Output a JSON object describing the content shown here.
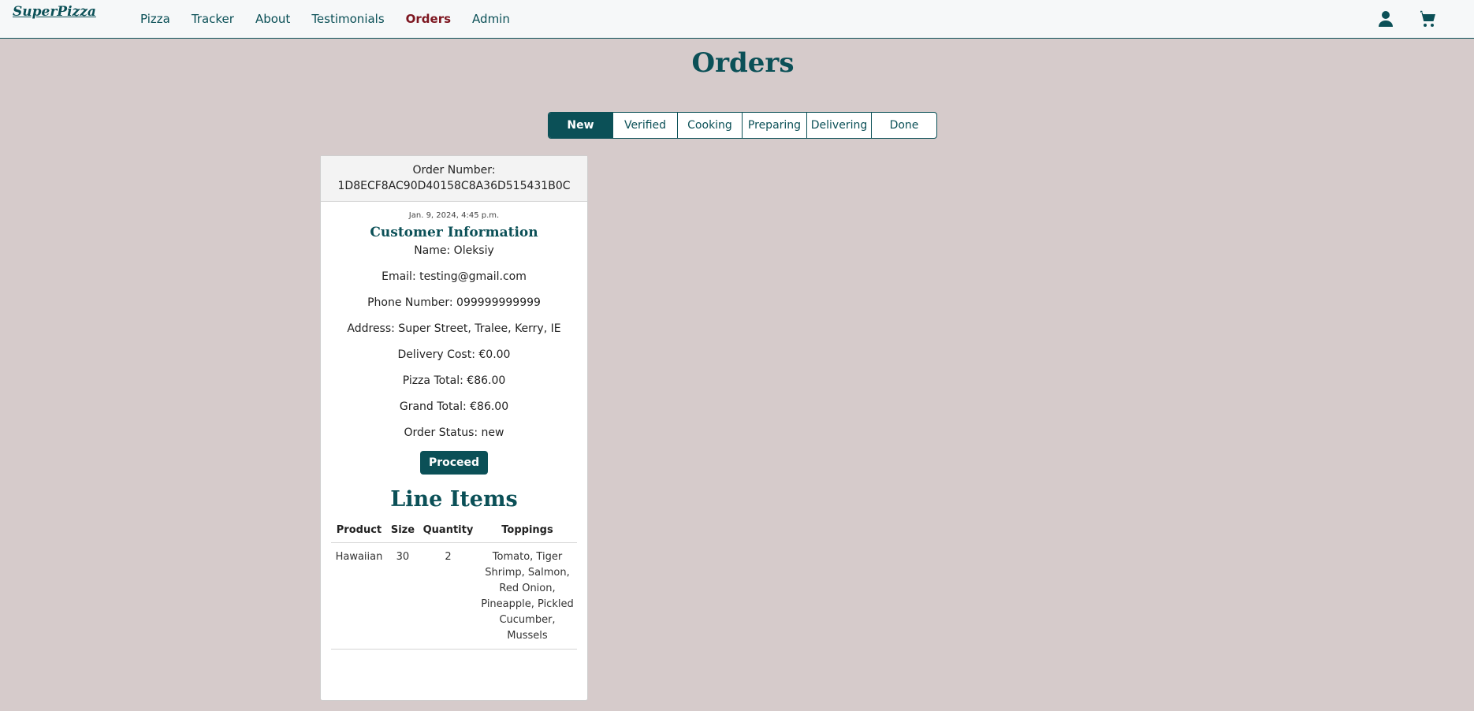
{
  "nav": {
    "brand": "SuperPizza",
    "links": [
      {
        "label": "Pizza"
      },
      {
        "label": "Tracker"
      },
      {
        "label": "About"
      },
      {
        "label": "Testimonials"
      },
      {
        "label": "Orders"
      },
      {
        "label": "Admin"
      }
    ],
    "active": "Orders",
    "icons": [
      "user-icon",
      "cart-icon"
    ]
  },
  "page": {
    "title": "Orders"
  },
  "tabs": [
    {
      "label": "New"
    },
    {
      "label": "Verified"
    },
    {
      "label": "Cooking"
    },
    {
      "label": "Preparing"
    },
    {
      "label": "Delivering"
    },
    {
      "label": "Done"
    }
  ],
  "active_tab": "New",
  "order": {
    "number_label": "Order Number:",
    "number": "1D8ECF8AC90D40158C8A36D515431B0C",
    "date": "Jan. 9, 2024, 4:45 p.m.",
    "customer_title": "Customer Information",
    "lines": {
      "name": "Name: Oleksiy",
      "email": "Email: testing@gmail.com",
      "phone": "Phone Number: 099999999999",
      "address": "Address: Super Street, Tralee, Kerry, IE",
      "delivery": "Delivery Cost: €0.00",
      "pizza_total": "Pizza Total: €86.00",
      "grand_total": "Grand Total: €86.00",
      "status": "Order Status: new"
    },
    "proceed_label": "Proceed",
    "line_items_title": "Line Items",
    "columns": [
      "Product",
      "Size",
      "Quantity",
      "Toppings"
    ],
    "items": [
      {
        "product": "Hawaiian",
        "size": "30",
        "quantity": "2",
        "toppings": "Tomato, Tiger Shrimp, Salmon, Red Onion, Pineapple, Pickled Cucumber, Mussels"
      }
    ]
  },
  "colors": {
    "primary": "#0b5057",
    "active_nav": "#7d1620",
    "background": "#d6cbcb"
  }
}
